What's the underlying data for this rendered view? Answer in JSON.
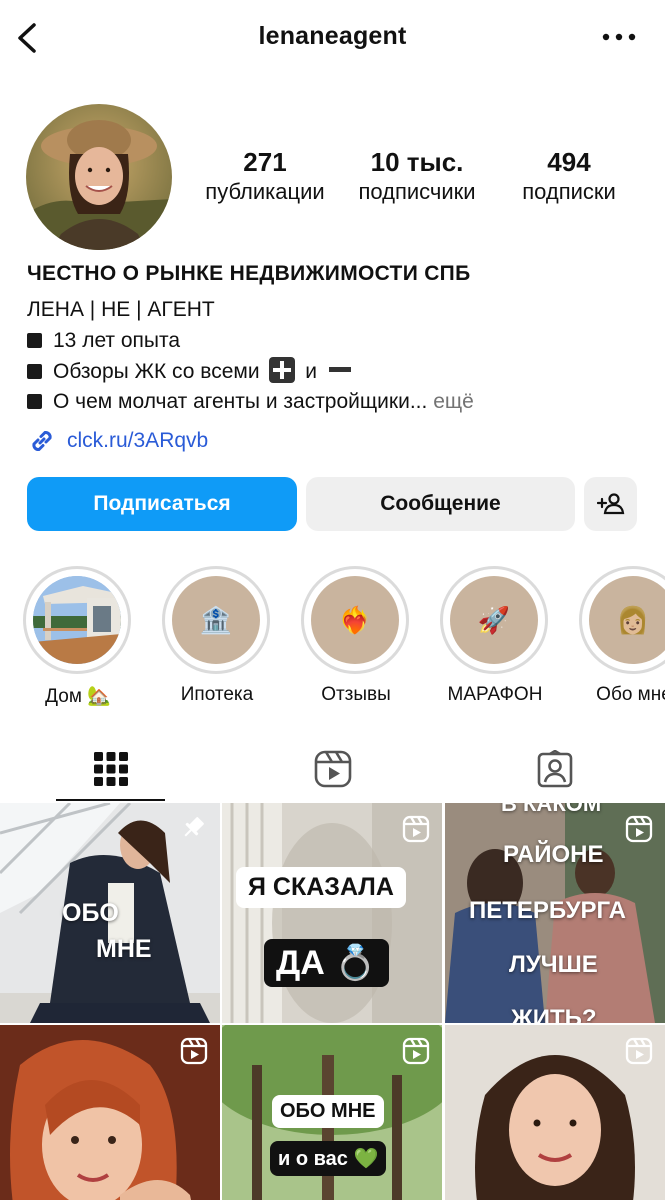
{
  "header": {
    "username": "lenaneagent",
    "back_icon": "chevron-left-icon",
    "more_icon": "ellipsis-icon"
  },
  "stats": {
    "posts": {
      "value": "271",
      "label": "публикации"
    },
    "followers": {
      "value": "10 тыс.",
      "label": "подписчики"
    },
    "following": {
      "value": "494",
      "label": "подписки"
    }
  },
  "bio": {
    "title": "ЧЕСТНО О РЫНКЕ НЕДВИЖИМОСТИ СПБ",
    "line1": "ЛЕНА | НЕ | АГЕНТ",
    "line2": "13 лет опыта",
    "line3_a": "Обзоры ЖК со всеми",
    "line3_b": "и",
    "line4": "О чем молчат агенты и застройщики...",
    "more": "ещё",
    "link": "clck.ru/3ARqvb"
  },
  "buttons": {
    "follow": "Подписаться",
    "message": "Сообщение",
    "add_user_icon": "add-user-icon"
  },
  "highlights": [
    {
      "label": "Дом 🏡",
      "emoji": ""
    },
    {
      "label": "Ипотека",
      "emoji": "🏦"
    },
    {
      "label": "Отзывы",
      "emoji": "❤️‍🔥"
    },
    {
      "label": "МАРАФОН",
      "emoji": "🚀"
    },
    {
      "label": "Обо мне",
      "emoji": "👩🏼"
    }
  ],
  "tabs": [
    {
      "icon": "grid-icon",
      "active": true
    },
    {
      "icon": "reels-icon",
      "active": false
    },
    {
      "icon": "tagged-icon",
      "active": false
    }
  ],
  "posts": [
    {
      "overlay": [
        "ОБО",
        "МНЕ"
      ],
      "type": "pinned"
    },
    {
      "overlay": [
        "Я СКАЗАЛА",
        "ДА 💍"
      ],
      "type": "reel"
    },
    {
      "overlay": [
        "В КАКОМ",
        "РАЙОНЕ",
        "ПЕТЕРБУРГА",
        "ЛУЧШЕ",
        "ЖИТЬ?"
      ],
      "type": "reel"
    },
    {
      "overlay": [],
      "type": "reel"
    },
    {
      "overlay": [
        "ОБО МНЕ",
        "и о вас 💚"
      ],
      "type": "reel"
    },
    {
      "overlay": [],
      "type": "reel"
    }
  ],
  "colors": {
    "accent": "#0f9bf7",
    "link": "#2a5bd7",
    "secondary_button": "#efefef",
    "muted": "#737373"
  }
}
